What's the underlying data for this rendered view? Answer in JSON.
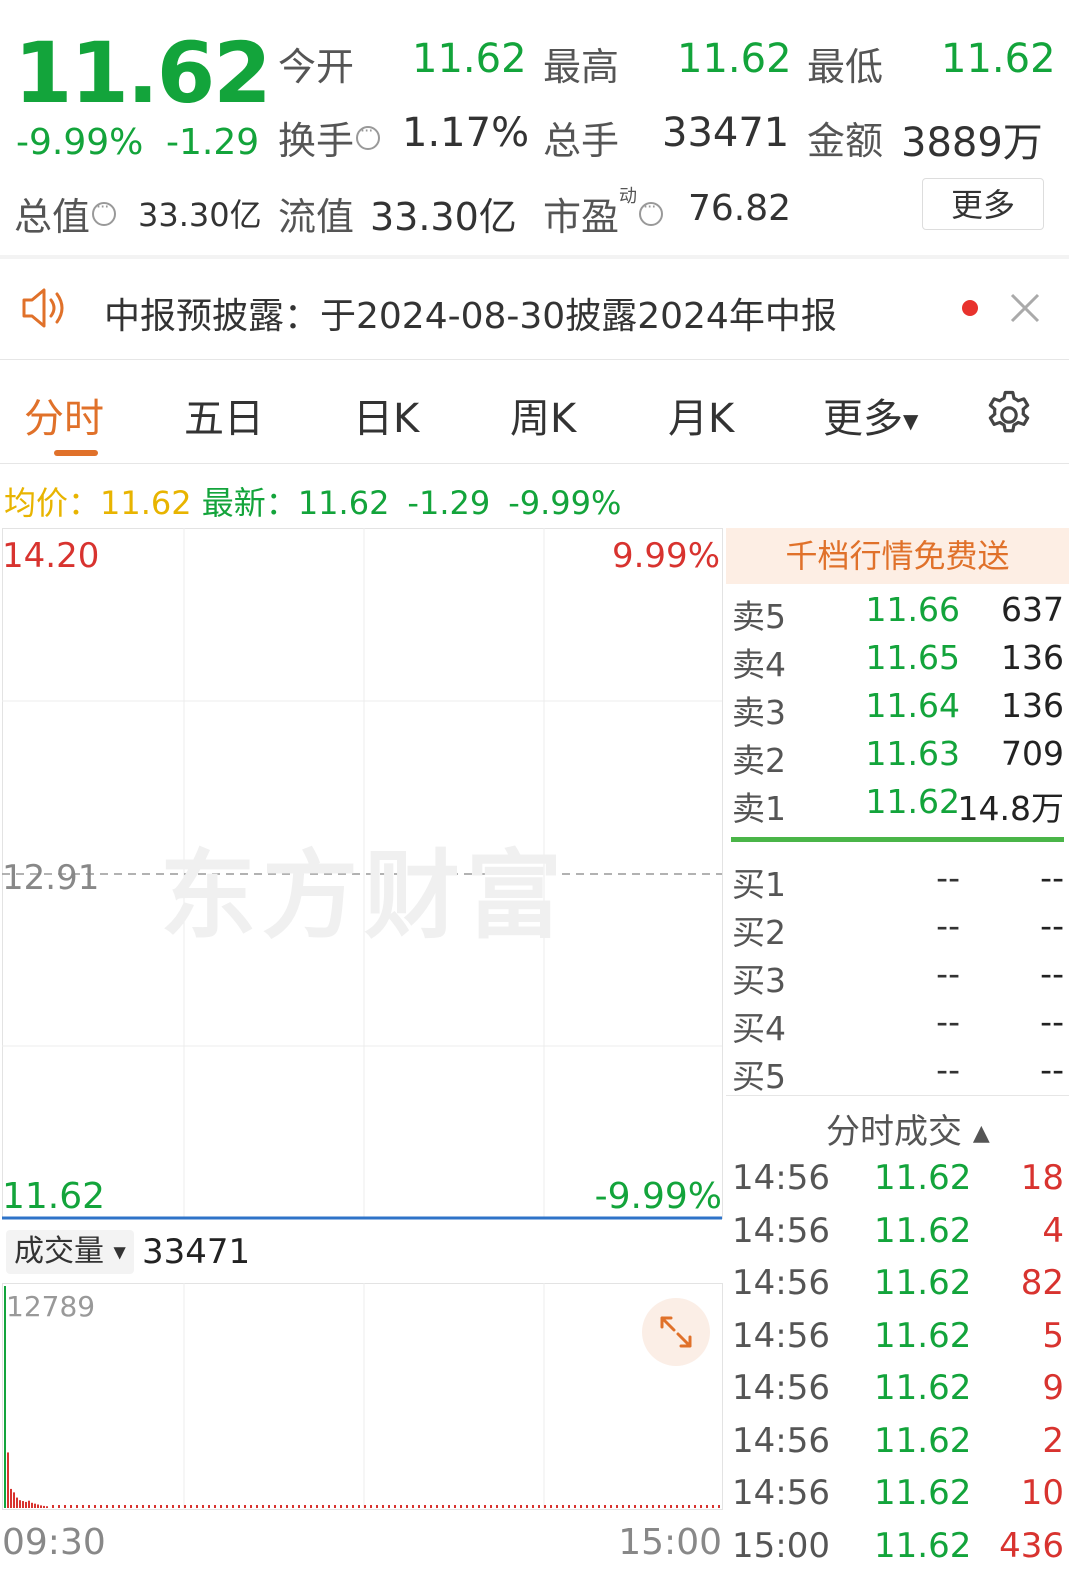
{
  "quote": {
    "price": "11.62",
    "change_pct": "-9.99%",
    "change_abs": "-1.29",
    "stats": {
      "open_label": "今开",
      "open": "11.62",
      "high_label": "最高",
      "high": "11.62",
      "low_label": "最低",
      "low": "11.62",
      "turnover_label": "换手",
      "turnover": "1.17%",
      "volume_label": "总手",
      "volume": "33471",
      "amount_label": "金额",
      "amount": "3889万",
      "mcap_label": "总值",
      "mcap": "33.30亿",
      "float_label": "流值",
      "float": "33.30亿",
      "pe_label": "市盈",
      "pe_sup": "动",
      "pe": "76.82"
    },
    "more_button": "更多"
  },
  "notice": {
    "text": "中报预披露：于2024-08-30披露2024年中报"
  },
  "tabs": [
    {
      "label": "分时"
    },
    {
      "label": "五日"
    },
    {
      "label": "日K"
    },
    {
      "label": "周K"
    },
    {
      "label": "月K"
    },
    {
      "label": "更多"
    }
  ],
  "summary": {
    "avg_label": "均价：",
    "avg": "11.62",
    "latest_label": "最新：",
    "latest": "11.62",
    "chg": "-1.29",
    "pct": "-9.99%"
  },
  "chart": {
    "y_top": "14.20",
    "y_mid": "12.91",
    "y_bottom": "11.62",
    "pct_top": "9.99%",
    "pct_bottom": "-9.99%",
    "watermark": "东方财富",
    "volume_selector": "成交量",
    "volume_total": "33471",
    "volume_max": "12789",
    "x_start": "09:30",
    "x_end": "15:00"
  },
  "chart_data": {
    "type": "line",
    "x": [
      "09:30",
      "15:00"
    ],
    "series": [
      {
        "values": [
          11.62,
          11.62
        ]
      }
    ],
    "ylim": [
      11.62,
      14.2
    ],
    "reference": 12.91,
    "volume": [
      12789,
      3200,
      1100,
      900,
      600,
      450,
      400,
      350,
      420,
      300,
      250,
      200,
      150,
      120,
      100
    ],
    "volume_ylim": [
      0,
      12789
    ]
  },
  "order_book": {
    "banner": "千档行情免费送",
    "asks": [
      {
        "label": "卖5",
        "price": "11.66",
        "vol": "637"
      },
      {
        "label": "卖4",
        "price": "11.65",
        "vol": "136"
      },
      {
        "label": "卖3",
        "price": "11.64",
        "vol": "136"
      },
      {
        "label": "卖2",
        "price": "11.63",
        "vol": "709"
      },
      {
        "label": "卖1",
        "price": "11.62",
        "vol": "14.8万"
      }
    ],
    "bids": [
      {
        "label": "买1",
        "price": "--",
        "vol": "--"
      },
      {
        "label": "买2",
        "price": "--",
        "vol": "--"
      },
      {
        "label": "买3",
        "price": "--",
        "vol": "--"
      },
      {
        "label": "买4",
        "price": "--",
        "vol": "--"
      },
      {
        "label": "买5",
        "price": "--",
        "vol": "--"
      }
    ]
  },
  "trades": {
    "header": "分时成交",
    "rows": [
      {
        "time": "14:56",
        "price": "11.62",
        "vol": "18"
      },
      {
        "time": "14:56",
        "price": "11.62",
        "vol": "4"
      },
      {
        "time": "14:56",
        "price": "11.62",
        "vol": "82"
      },
      {
        "time": "14:56",
        "price": "11.62",
        "vol": "5"
      },
      {
        "time": "14:56",
        "price": "11.62",
        "vol": "9"
      },
      {
        "time": "14:56",
        "price": "11.62",
        "vol": "2"
      },
      {
        "time": "14:56",
        "price": "11.62",
        "vol": "10"
      },
      {
        "time": "15:00",
        "price": "11.62",
        "vol": "436"
      }
    ]
  },
  "colors": {
    "up": "#d8332f",
    "down": "#13a43b",
    "accent": "#e0712a",
    "avg": "#e8b400",
    "line": "#2e73c8"
  }
}
